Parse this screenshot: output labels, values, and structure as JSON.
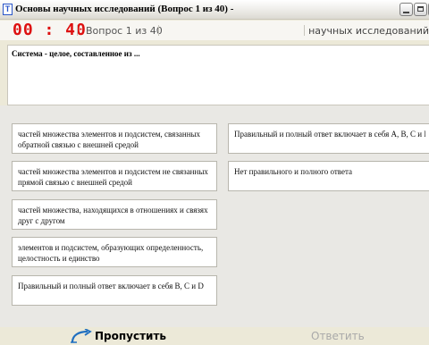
{
  "window": {
    "title": "Основы научных исследований (Вопрос 1 из 40) -",
    "icon_letter": "T"
  },
  "toolbar": {
    "timer": "00 : 40",
    "question_counter": "Вопрос 1 из 40",
    "right_text": "Основы научных исследований"
  },
  "question": {
    "text": "Система - целое, составленное из ..."
  },
  "answers": [
    {
      "text": "частей множества элементов и подсистем, связанных обратной связью с внешней средой"
    },
    {
      "text": "частей множества элементов и подсистем не связанных прямой связью с внешней средой"
    },
    {
      "text": "частей множества, находящихся в отношениях и связях друг с другом"
    },
    {
      "text": "элементов и подсистем, образующих определенность, целостность и единство"
    },
    {
      "text": "Правильный и полный ответ включает в себя B, C и D"
    },
    {
      "text": "Правильный и полный ответ включает в себя A, B, C и D"
    },
    {
      "text": "Нет правильного и полного ответа"
    }
  ],
  "footer": {
    "skip_label": "Пропустить",
    "answer_label": "Ответить",
    "skip_icon": "skip-arrow-icon"
  },
  "colors": {
    "timer": "#dd1111",
    "accent": "#2a55c9"
  }
}
